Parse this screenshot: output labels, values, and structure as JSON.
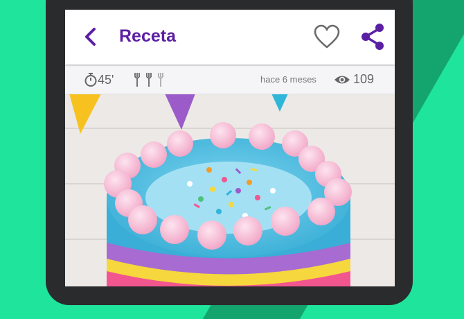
{
  "header": {
    "title": "Receta"
  },
  "icons": {
    "back": "chevron-left-icon",
    "favorite": "heart-outline-icon",
    "share": "share-icon",
    "timer": "stopwatch-icon",
    "difficulty": "fork-icon",
    "views": "eye-icon"
  },
  "meta": {
    "time": "45'",
    "posted": "hace 6 meses",
    "views": "109",
    "difficulty_level": "3 of 3 forks"
  },
  "colors": {
    "brand_purple": "#5b1fa3",
    "background_green": "#1fe59c"
  },
  "image": {
    "subject": "rainbow layer cake"
  }
}
